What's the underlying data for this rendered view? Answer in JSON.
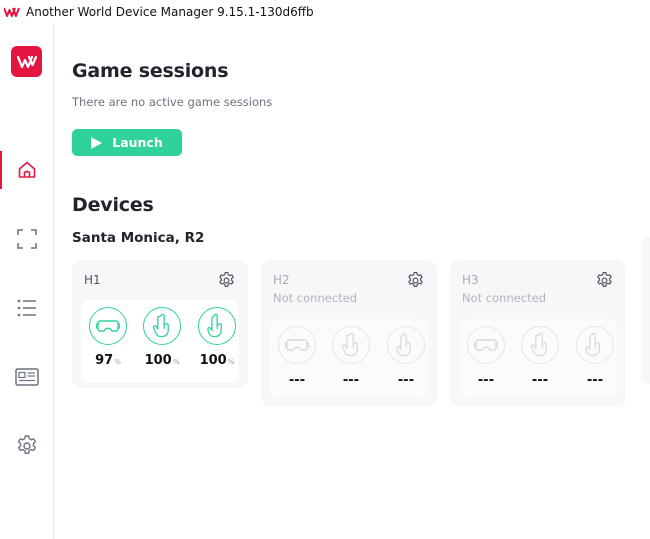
{
  "window": {
    "title": "Another World Device Manager 9.15.1-130d6ffb",
    "brand_color": "#e4163f",
    "accent_color": "#2fd39a"
  },
  "sidebar": {
    "items": [
      {
        "name": "home",
        "icon": "home-icon",
        "active": true
      },
      {
        "name": "scan",
        "icon": "scan-frame-icon",
        "active": false
      },
      {
        "name": "list",
        "icon": "list-icon",
        "active": false
      },
      {
        "name": "news",
        "icon": "newspaper-icon",
        "active": false
      },
      {
        "name": "settings",
        "icon": "gear-icon",
        "active": false
      }
    ]
  },
  "sessions": {
    "heading": "Game sessions",
    "empty_text": "There are no active game sessions",
    "launch_label": "Launch"
  },
  "devices": {
    "heading": "Devices",
    "location": "Santa Monica, R2",
    "cards": [
      {
        "name": "H1",
        "status": "",
        "connected": true,
        "items": [
          {
            "icon": "headset-icon",
            "value": "97",
            "unit": "%",
            "level": 0.97
          },
          {
            "icon": "hand-controller-left-icon",
            "value": "100",
            "unit": "%",
            "level": 1.0
          },
          {
            "icon": "hand-controller-right-icon",
            "value": "100",
            "unit": "%",
            "level": 1.0
          }
        ]
      },
      {
        "name": "H2",
        "status": "Not connected",
        "connected": false,
        "items": [
          {
            "icon": "headset-icon",
            "value": "---",
            "unit": ""
          },
          {
            "icon": "hand-controller-left-icon",
            "value": "---",
            "unit": ""
          },
          {
            "icon": "hand-controller-right-icon",
            "value": "---",
            "unit": ""
          }
        ]
      },
      {
        "name": "H3",
        "status": "Not connected",
        "connected": false,
        "items": [
          {
            "icon": "headset-icon",
            "value": "---",
            "unit": ""
          },
          {
            "icon": "hand-controller-left-icon",
            "value": "---",
            "unit": ""
          },
          {
            "icon": "hand-controller-right-icon",
            "value": "---",
            "unit": ""
          }
        ]
      }
    ]
  }
}
